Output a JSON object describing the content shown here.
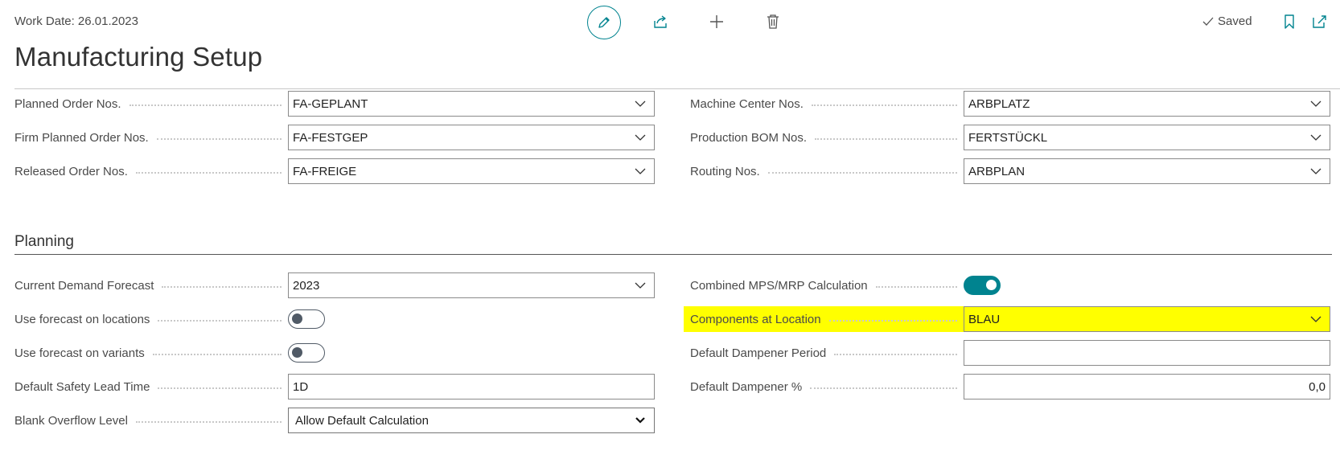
{
  "header": {
    "work_date": "Work Date: 26.01.2023",
    "title": "Manufacturing Setup",
    "saved_label": "Saved"
  },
  "numbering": {
    "left": [
      {
        "label": "Planned Order Nos.",
        "value": "FA-GEPLANT"
      },
      {
        "label": "Firm Planned Order Nos.",
        "value": "FA-FESTGEP"
      },
      {
        "label": "Released Order Nos.",
        "value": "FA-FREIGE"
      }
    ],
    "right": [
      {
        "label": "Machine Center Nos.",
        "value": "ARBPLATZ"
      },
      {
        "label": "Production BOM Nos.",
        "value": "FERTSTÜCKL"
      },
      {
        "label": "Routing Nos.",
        "value": "ARBPLAN"
      }
    ]
  },
  "planning": {
    "section_title": "Planning",
    "current_demand_forecast": {
      "label": "Current Demand Forecast",
      "value": "2023"
    },
    "use_forecast_locations": {
      "label": "Use forecast on locations",
      "on": false
    },
    "use_forecast_variants": {
      "label": "Use forecast on variants",
      "on": false
    },
    "default_safety_lead_time": {
      "label": "Default Safety Lead Time",
      "value": "1D"
    },
    "blank_overflow_level": {
      "label": "Blank Overflow Level",
      "value": "Allow Default Calculation"
    },
    "combined_mps_mrp": {
      "label": "Combined MPS/MRP Calculation",
      "on": true
    },
    "components_at_location": {
      "label": "Components at Location",
      "value": "BLAU"
    },
    "default_dampener_period": {
      "label": "Default Dampener Period",
      "value": ""
    },
    "default_dampener_pct": {
      "label": "Default Dampener %",
      "value": "0,0"
    }
  },
  "colors": {
    "accent": "#00838f",
    "highlight": "#ffff00"
  }
}
